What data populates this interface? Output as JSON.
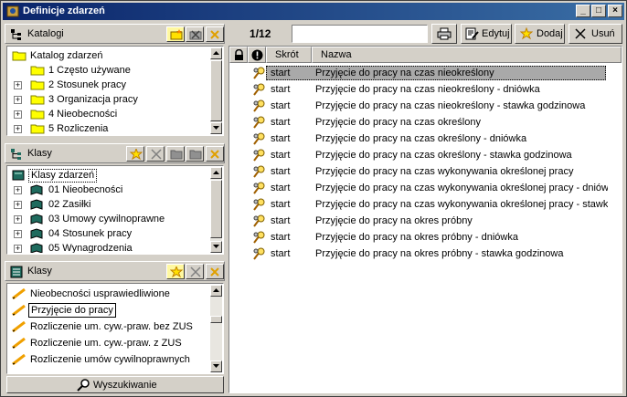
{
  "window": {
    "title": "Definicje zdarzeń",
    "buttons": [
      "_",
      "□",
      "×"
    ]
  },
  "katalogi": {
    "title": "Katalogi",
    "items": [
      {
        "label": "Katalog zdarzeń",
        "level": 0,
        "expander": ""
      },
      {
        "label": "1 Często używane",
        "level": 1,
        "expander": ""
      },
      {
        "label": "2 Stosunek pracy",
        "level": 1,
        "expander": "+"
      },
      {
        "label": "3 Organizacja pracy",
        "level": 1,
        "expander": "+"
      },
      {
        "label": "4 Nieobecności",
        "level": 1,
        "expander": "+"
      },
      {
        "label": "5 Rozliczenia",
        "level": 1,
        "expander": "+"
      }
    ]
  },
  "klasy_tree": {
    "title": "Klasy",
    "items": [
      {
        "label": "Klasy zdarzeń",
        "level": 0,
        "expander": ""
      },
      {
        "label": "01 Nieobecności",
        "level": 1,
        "expander": "+"
      },
      {
        "label": "02 Zasiłki",
        "level": 1,
        "expander": "+"
      },
      {
        "label": "03 Umowy cywilnoprawne",
        "level": 1,
        "expander": "+"
      },
      {
        "label": "04 Stosunek pracy",
        "level": 1,
        "expander": "+"
      },
      {
        "label": "05 Wynagrodzenia",
        "level": 1,
        "expander": "+"
      }
    ]
  },
  "klasy_list": {
    "title": "Klasy",
    "items": [
      "Nieobecności usprawiedliwione",
      "Przyjęcie do pracy",
      "Rozliczenie um. cyw.-praw. bez ZUS",
      "Rozliczenie um. cyw.-praw. z ZUS",
      "Rozliczenie umów cywilnoprawnych"
    ],
    "selected_index": 1
  },
  "search_button": "Wyszukiwanie",
  "toolbar": {
    "counter_current": "1",
    "counter_total": "/12",
    "search_value": "",
    "edit_label": "Edytuj",
    "add_label": "Dodaj",
    "delete_label": "Usuń"
  },
  "grid": {
    "columns": {
      "skrot": "Skrót",
      "nazwa": "Nazwa"
    },
    "selected_index": 0,
    "rows": [
      {
        "skrot": "start",
        "nazwa": "Przyjęcie do pracy na czas nieokreślony"
      },
      {
        "skrot": "start",
        "nazwa": "Przyjęcie do pracy na czas nieokreślony - dniówka"
      },
      {
        "skrot": "start",
        "nazwa": "Przyjęcie do pracy na czas nieokreślony - stawka godzinowa"
      },
      {
        "skrot": "start",
        "nazwa": "Przyjęcie do pracy na czas określony"
      },
      {
        "skrot": "start",
        "nazwa": "Przyjęcie do pracy na czas określony - dniówka"
      },
      {
        "skrot": "start",
        "nazwa": "Przyjęcie do pracy na czas określony - stawka godzinowa"
      },
      {
        "skrot": "start",
        "nazwa": "Przyjęcie do pracy na czas wykonywania określonej pracy"
      },
      {
        "skrot": "start",
        "nazwa": "Przyjęcie do pracy na czas wykonywania określonej pracy - dniów..."
      },
      {
        "skrot": "start",
        "nazwa": "Przyjęcie do pracy na czas wykonywania określonej pracy - stawk..."
      },
      {
        "skrot": "start",
        "nazwa": "Przyjęcie do pracy na okres próbny"
      },
      {
        "skrot": "start",
        "nazwa": "Przyjęcie do pracy na okres próbny - dniówka"
      },
      {
        "skrot": "start",
        "nazwa": "Przyjęcie do pracy na okres próbny - stawka godzinowa"
      }
    ]
  },
  "colors": {
    "title_gradient_start": "#0a246a",
    "title_gradient_end": "#3a6ea5",
    "face": "#d4d0c8",
    "selection": "#a9a9a9",
    "folder": "#ffff00",
    "book": "#1f6b5e"
  }
}
